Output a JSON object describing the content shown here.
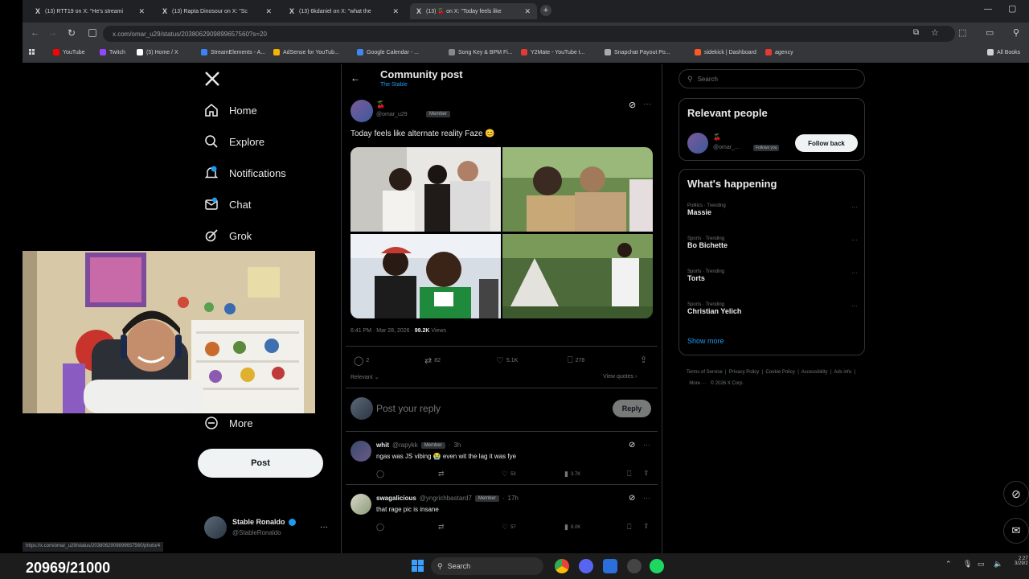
{
  "browser": {
    "tabs": [
      {
        "label": "(13) RTT19 on X: \"He's streami"
      },
      {
        "label": "(13) Rapta Dinosour on X: \"Sc"
      },
      {
        "label": "(13) 6kdaniel on X: \"what the"
      },
      {
        "label": "(13) 🍒 on X: \"Today feels like"
      }
    ],
    "url": "x.com/omar_u29/status/2038062909899657560?s=20",
    "bookmarks": [
      {
        "label": "YouTube",
        "color": "#ff0000"
      },
      {
        "label": "Twitch",
        "color": "#9146ff"
      },
      {
        "label": "(5) Home / X",
        "color": "#ffffff"
      },
      {
        "label": "StreamElements - A...",
        "color": "#3b82f6"
      },
      {
        "label": "AdSense for YouTub...",
        "color": "#f4b400"
      },
      {
        "label": "Google Calendar - ...",
        "color": "#4285f4"
      },
      {
        "label": "Song Key & BPM Fi...",
        "color": "#888888"
      },
      {
        "label": "Y2Mate - YouTube t...",
        "color": "#e53935"
      },
      {
        "label": "Snapchat Payout Po...",
        "color": "#aaaaaa"
      },
      {
        "label": "sidekick | Dashboard",
        "color": "#ff5722"
      },
      {
        "label": "agency",
        "color": "#e53935"
      }
    ],
    "all_bookmarks": "All Books",
    "status_url": "https://x.com/omar_u29/status/2038062909899657560/photo/4"
  },
  "nav": {
    "items": [
      {
        "label": "Home"
      },
      {
        "label": "Explore"
      },
      {
        "label": "Notifications"
      },
      {
        "label": "Chat"
      },
      {
        "label": "Grok"
      },
      {
        "label": "More"
      }
    ],
    "post_label": "Post",
    "account_name": "Stable Ronaldo",
    "account_handle": "@StableRonaldo"
  },
  "post": {
    "header_title": "Community post",
    "community": "The Stable",
    "author_name": "🍒",
    "author_handle": "@omar_u29",
    "author_badge": "Member",
    "text": "Today feels like alternate reality Faze 😊",
    "timestamp": "6:41 PM · Mar 28, 2026 ·",
    "views_count": "99.2K",
    "views_label": "Views",
    "replies": "2",
    "reposts": "82",
    "likes": "5.1K",
    "bookmarks": "278",
    "sort_label": "Relevant",
    "view_quotes": "View quotes",
    "reply_placeholder": "Post your reply",
    "reply_button": "Reply"
  },
  "replies": [
    {
      "name": "whit",
      "handle": "@rapykk",
      "badge": "Member",
      "time": "3h",
      "text": "ngas was JS vibing 😭 even wit the lag it was fye",
      "likes": "53",
      "views": "3.7K"
    },
    {
      "name": "swagalicious",
      "handle": "@yngrichbastard7",
      "badge": "Member",
      "time": "17h",
      "text": "that rage pic is insane",
      "likes": "57",
      "views": "8.0K"
    }
  ],
  "right": {
    "search_placeholder": "Search",
    "relevant_title": "Relevant people",
    "relevant_name": "🍒",
    "relevant_handle": "@omar_...",
    "relevant_follows": "Follows you",
    "follow_back": "Follow back",
    "happening_title": "What's happening",
    "trends": [
      {
        "category": "Politics · Trending",
        "name": "Massie"
      },
      {
        "category": "Sports · Trending",
        "name": "Bo Bichette"
      },
      {
        "category": "Sports · Trending",
        "name": "Torts"
      },
      {
        "category": "Sports · Trending",
        "name": "Christian Yelich"
      }
    ],
    "show_more": "Show more",
    "footer_links": [
      "Terms of Service",
      "Privacy Policy",
      "Cookie Policy",
      "Accessibility",
      "Ads info",
      "More ···",
      "© 2026 X Corp."
    ]
  },
  "overlay": {
    "counter": "20969/21000"
  },
  "taskbar": {
    "search_label": "Search",
    "time": "2:27",
    "date": "3/29/2"
  }
}
